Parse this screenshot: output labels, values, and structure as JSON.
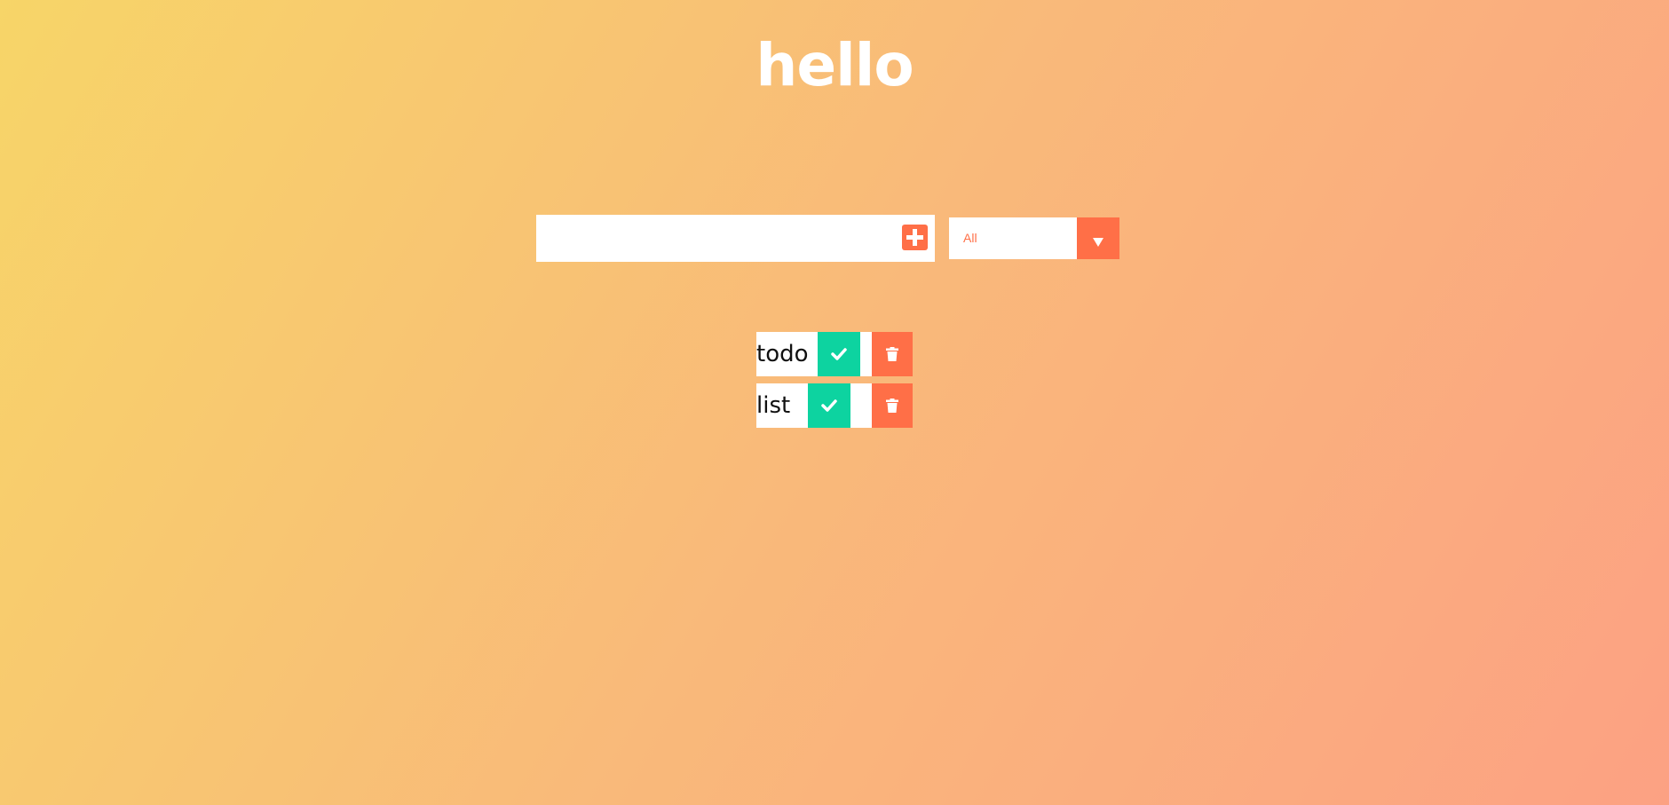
{
  "header": {
    "title": "hello"
  },
  "form": {
    "input_value": "",
    "input_placeholder": "",
    "add_icon": "plus-square-icon",
    "filter": {
      "selected": "All",
      "arrow_icon": "caret-down-icon"
    }
  },
  "todos": [
    {
      "text": "todo",
      "complete_icon": "check-icon",
      "delete_icon": "trash-icon"
    },
    {
      "text": "list",
      "complete_icon": "check-icon",
      "delete_icon": "trash-icon"
    }
  ],
  "colors": {
    "accent": "#ff6f47",
    "complete": "#0dd3a0",
    "gradient_start": "#f7d568",
    "gradient_end": "#fca183",
    "surface": "#ffffff"
  }
}
